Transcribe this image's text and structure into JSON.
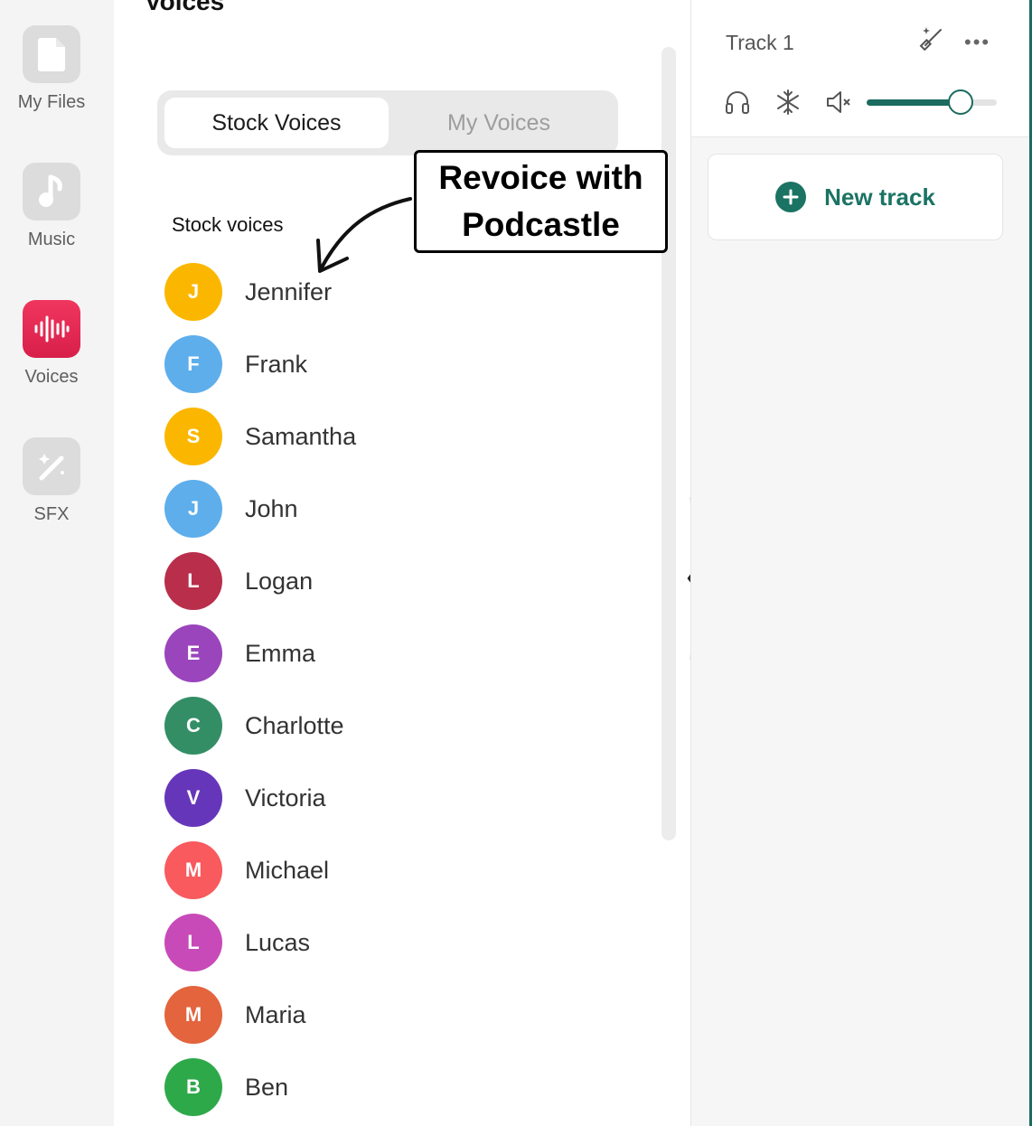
{
  "sidebar": {
    "items": [
      {
        "label": "My Files",
        "icon": "file-icon",
        "active": false
      },
      {
        "label": "Music",
        "icon": "music-note-icon",
        "active": false
      },
      {
        "label": "Voices",
        "icon": "waveform-icon",
        "active": true
      },
      {
        "label": "SFX",
        "icon": "magic-wand-icon",
        "active": false
      }
    ]
  },
  "panel": {
    "title": "Voices",
    "tabs": [
      {
        "label": "Stock Voices",
        "active": true
      },
      {
        "label": "My Voices",
        "active": false
      }
    ],
    "section_label": "Stock voices",
    "voices": [
      {
        "initial": "J",
        "name": "Jennifer",
        "color": "#FBB700"
      },
      {
        "initial": "F",
        "name": "Frank",
        "color": "#5EAEEC"
      },
      {
        "initial": "S",
        "name": "Samantha",
        "color": "#FBB700"
      },
      {
        "initial": "J",
        "name": "John",
        "color": "#5EAEEC"
      },
      {
        "initial": "L",
        "name": "Logan",
        "color": "#B92E4B"
      },
      {
        "initial": "E",
        "name": "Emma",
        "color": "#9A45BC"
      },
      {
        "initial": "C",
        "name": "Charlotte",
        "color": "#338E65"
      },
      {
        "initial": "V",
        "name": "Victoria",
        "color": "#6636BA"
      },
      {
        "initial": "M",
        "name": "Michael",
        "color": "#F85A5E"
      },
      {
        "initial": "L",
        "name": "Lucas",
        "color": "#C84AB8"
      },
      {
        "initial": "M",
        "name": "Maria",
        "color": "#E3643D"
      },
      {
        "initial": "B",
        "name": "Ben",
        "color": "#2EA94A"
      }
    ]
  },
  "callout": {
    "line1": "Revoice with",
    "line2": "Podcastle"
  },
  "track": {
    "title": "Track 1",
    "more_label": "•••",
    "volume": 0.72,
    "new_track_label": "New track"
  },
  "colors": {
    "accent": "#1B7364",
    "voices_active": "#E82653"
  }
}
